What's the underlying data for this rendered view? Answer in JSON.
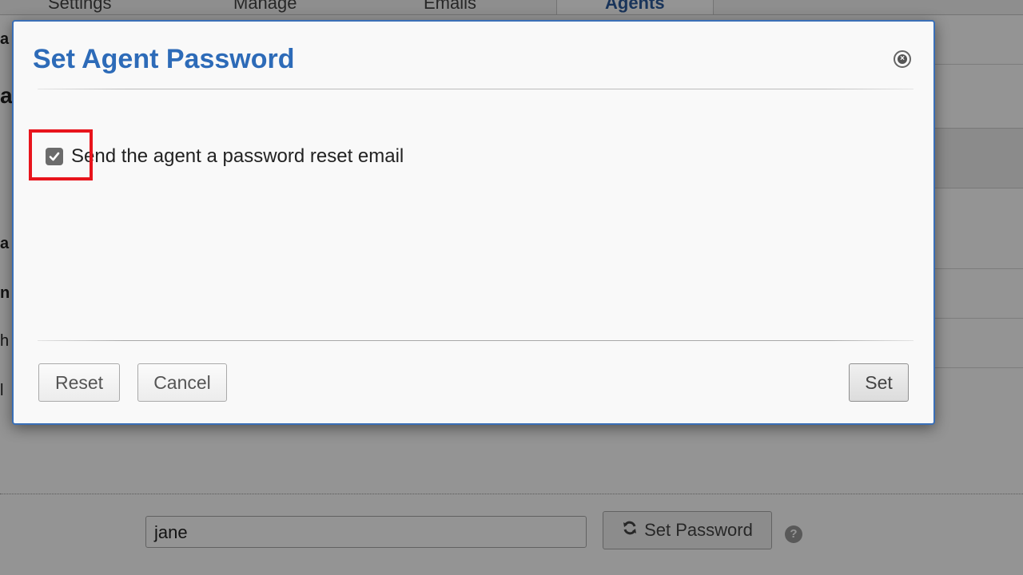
{
  "background": {
    "tabs": [
      {
        "label": "Settings"
      },
      {
        "label": "Manage"
      },
      {
        "label": "Emails"
      },
      {
        "label": "Agents"
      }
    ],
    "username_value": "jane",
    "set_password_label": "Set Password",
    "help_label": "?"
  },
  "dialog": {
    "title": "Set Agent Password",
    "send_reset_email": {
      "label": "Send the agent a password reset email",
      "checked": true
    },
    "buttons": {
      "reset": "Reset",
      "cancel": "Cancel",
      "set": "Set"
    }
  },
  "colors": {
    "title": "#2d6bb8",
    "dialog_border": "#3a6fb7",
    "highlight": "#e8141c"
  },
  "icons": {
    "close": "close-circle-icon",
    "refresh": "refresh-icon",
    "help": "help-circle-icon",
    "check": "checkmark-icon"
  }
}
